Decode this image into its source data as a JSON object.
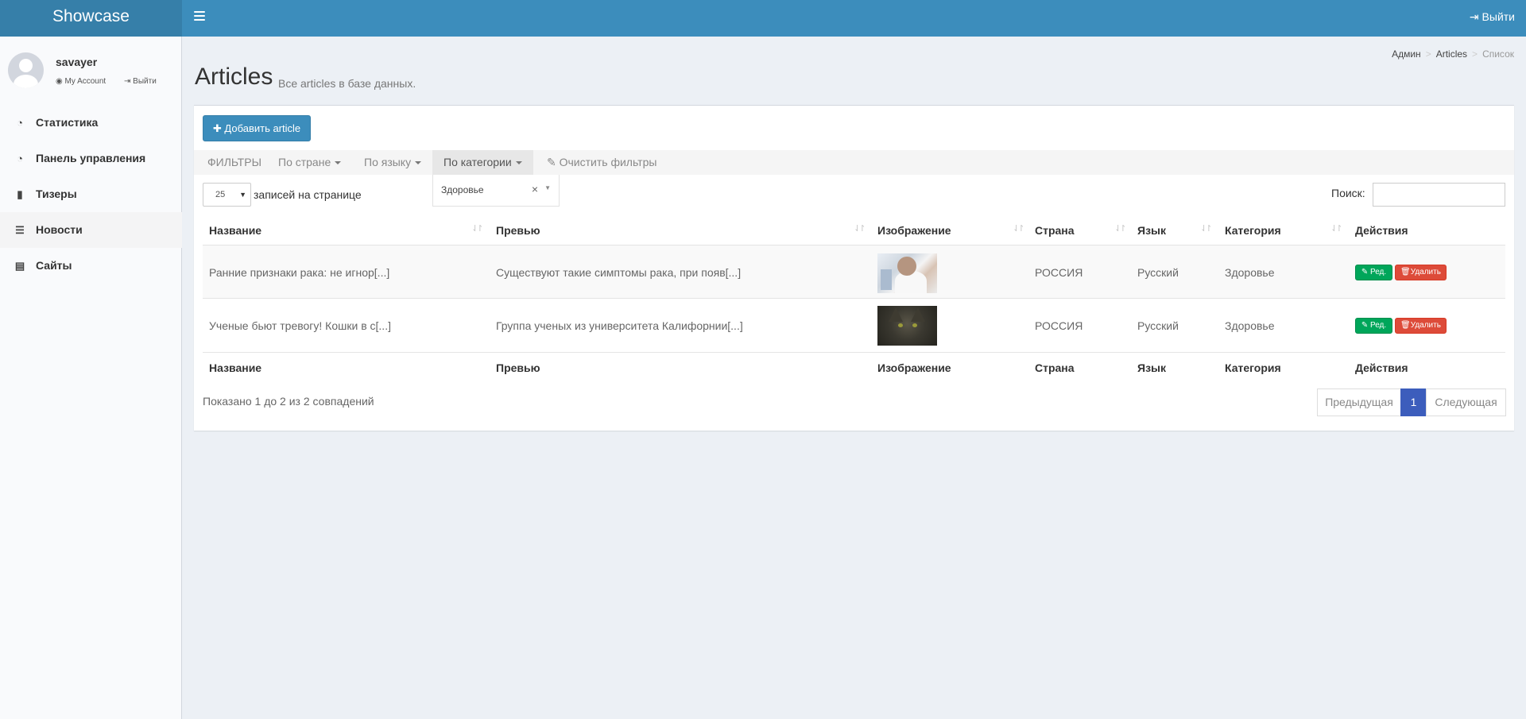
{
  "header": {
    "logo": "Showcase",
    "logout_label": "Выйти"
  },
  "user": {
    "name": "savayer",
    "my_account": "My Account",
    "logout": "Выйти"
  },
  "sidebar": {
    "items": [
      {
        "label": "Статистика",
        "icon": "dashboard-icon"
      },
      {
        "label": "Панель управления",
        "icon": "dashboard-icon"
      },
      {
        "label": "Тизеры",
        "icon": "file-icon"
      },
      {
        "label": "Новости",
        "icon": "list-icon"
      },
      {
        "label": "Сайты",
        "icon": "newspaper-icon"
      }
    ],
    "active": "Новости"
  },
  "page": {
    "title": "Articles",
    "subtitle": "Все articles в базе данных.",
    "breadcrumb": [
      "Админ",
      "Articles",
      "Список"
    ]
  },
  "toolbar": {
    "add_label": "Добавить article"
  },
  "filters": {
    "label": "ФИЛЬТРЫ",
    "by_country": "По стране",
    "by_language": "По языку",
    "by_category": "По категории",
    "clear": "Очистить фильтры",
    "category_value": "Здоровье"
  },
  "table_controls": {
    "page_length": "25",
    "page_length_label": "записей на странице",
    "search_label": "Поиск:",
    "search_value": ""
  },
  "table": {
    "columns": [
      "Название",
      "Превью",
      "Изображение",
      "Страна",
      "Язык",
      "Категория",
      "Действия"
    ],
    "rows": [
      {
        "title": "Ранние признаки рака: не игнор[...]",
        "preview": "Существуют такие симптомы рака, при появ[...]",
        "country": "РОССИЯ",
        "language": "Русский",
        "category": "Здоровье",
        "edit": "Ред.",
        "delete": "Удалить"
      },
      {
        "title": "Ученые бьют тревогу! Кошки в с[...]",
        "preview": "Группа ученых из университета Калифорнии[...]",
        "country": "РОССИЯ",
        "language": "Русский",
        "category": "Здоровье",
        "edit": "Ред.",
        "delete": "Удалить"
      }
    ]
  },
  "footer": {
    "info": "Показано 1 до 2 из 2 совпадений",
    "prev": "Предыдущая",
    "page": "1",
    "next": "Следующая"
  },
  "colors": {
    "header": "#3c8dbc",
    "logo_bg": "#367fa9",
    "edit": "#00a65a",
    "delete": "#dd4b39",
    "page_active": "#3c5dbc"
  }
}
